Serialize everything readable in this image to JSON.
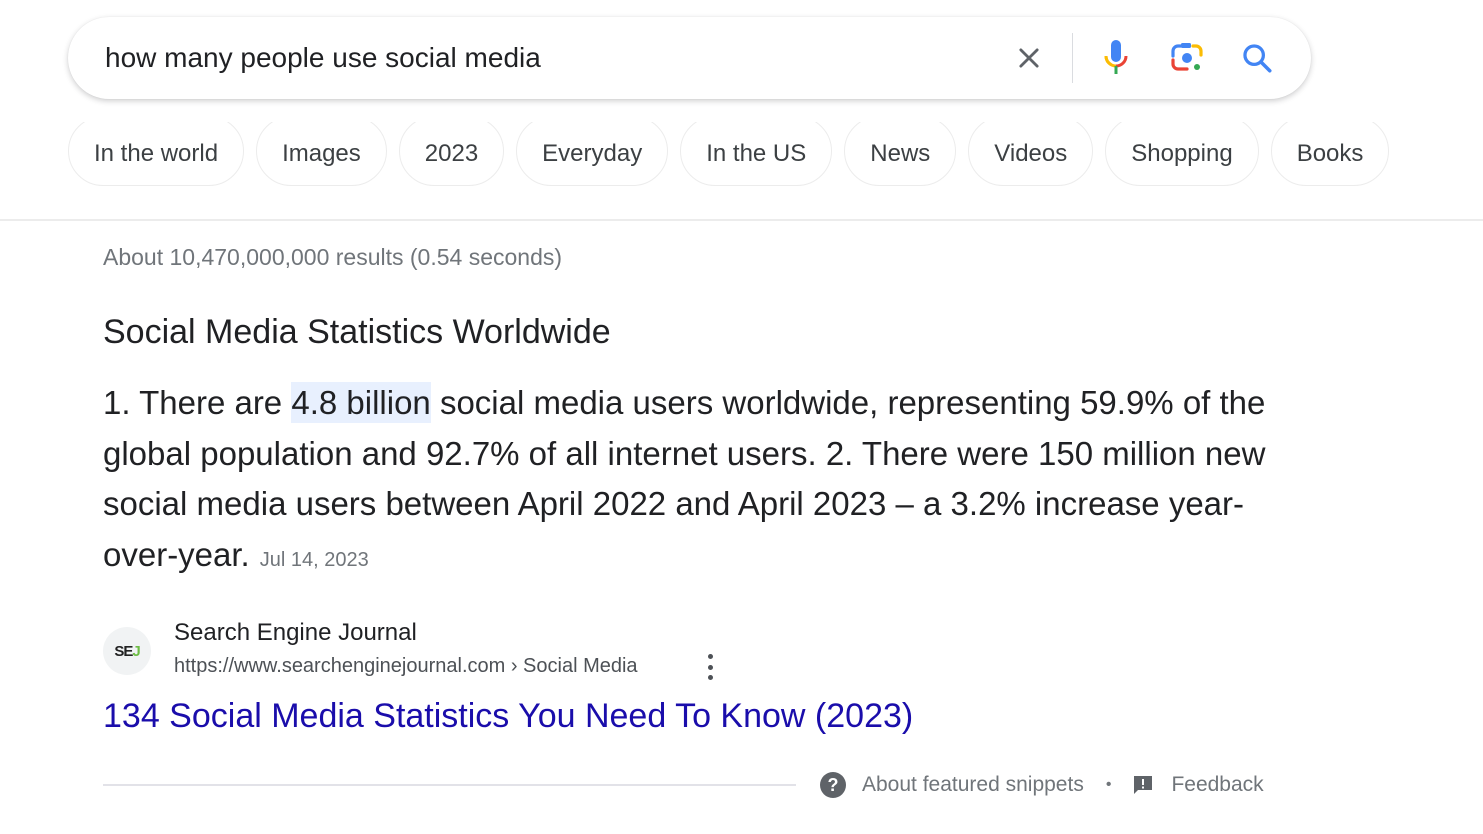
{
  "search": {
    "query": "how many people use social media",
    "icons": {
      "clear": "close-icon",
      "voice": "microphone-icon",
      "lens": "google-lens-icon",
      "submit": "search-icon"
    }
  },
  "chips": [
    {
      "label": "In the world"
    },
    {
      "label": "Images"
    },
    {
      "label": "2023"
    },
    {
      "label": "Everyday"
    },
    {
      "label": "In the US"
    },
    {
      "label": "News"
    },
    {
      "label": "Videos"
    },
    {
      "label": "Shopping"
    },
    {
      "label": "Books"
    }
  ],
  "results": {
    "stats": "About 10,470,000,000 results (0.54 seconds)"
  },
  "featured_snippet": {
    "heading": "Social Media Statistics Worldwide",
    "body_prefix": "1. There are ",
    "highlight": "4.8 billion",
    "body_suffix": " social media users worldwide, representing 59.9% of the global population and 92.7% of all internet users. 2. There were 150 million new social media users between April 2022 and April 2023 – a 3.2% increase year-over-year.",
    "date": "Jul 14, 2023",
    "source": {
      "favicon_text_main": "SE",
      "favicon_text_accent": "J",
      "name": "Search Engine Journal",
      "url": "https://www.searchenginejournal.com › Social Media",
      "title": "134 Social Media Statistics You Need To Know (2023)"
    },
    "footer": {
      "about_label": "About featured snippets",
      "separator": "•",
      "feedback_label": "Feedback"
    }
  },
  "colors": {
    "link": "#1a0dab",
    "highlight_bg": "#e8f0fe",
    "google_blue": "#4285f4",
    "google_red": "#ea4335",
    "google_yellow": "#fbbc04",
    "google_green": "#34a853"
  }
}
